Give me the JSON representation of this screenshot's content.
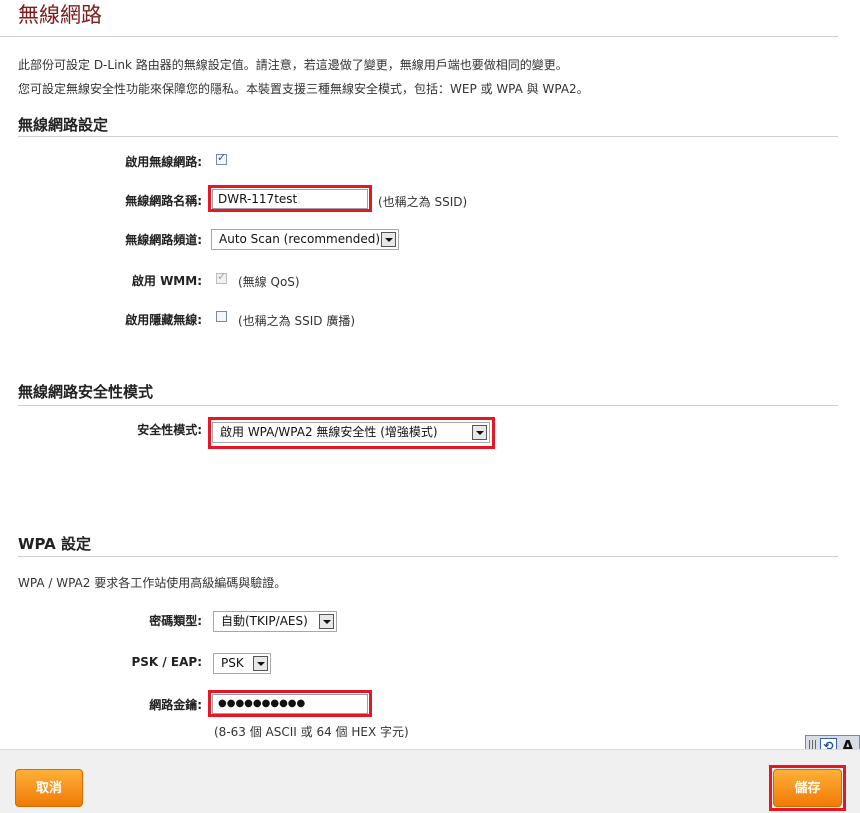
{
  "page": {
    "title": "無線網路",
    "intro_line1": "此部份可設定 D-Link 路由器的無線設定值。請注意，若這邊做了變更，無線用戶端也要做相同的變更。",
    "intro_line2": "您可設定無線安全性功能來保障您的隱私。本裝置支援三種無線安全模式，包括：WEP 或 WPA 與 WPA2。"
  },
  "wireless_settings": {
    "section_title": "無線網路設定",
    "enable_label": "啟用無線網路:",
    "enable_checked": true,
    "ssid_label": "無線網路名稱:",
    "ssid_value": "DWR-117test",
    "ssid_note": "(也稱之為 SSID)",
    "channel_label": "無線網路頻道:",
    "channel_value": "Auto Scan (recommended)",
    "wmm_label": "啟用 WMM:",
    "wmm_checked": true,
    "wmm_note": "(無線 QoS)",
    "hidden_label": "啟用隱藏無線:",
    "hidden_checked": false,
    "hidden_note": "(也稱之為 SSID 廣播)"
  },
  "security_mode": {
    "section_title": "無線網路安全性模式",
    "mode_label": "安全性模式:",
    "mode_value": "啟用 WPA/WPA2 無線安全性 (增強模式)"
  },
  "wpa_settings": {
    "section_title": "WPA 設定",
    "description": "WPA / WPA2 要求各工作站使用高級編碼與驗證。",
    "cipher_label": "密碼類型:",
    "cipher_value": "自動(TKIP/AES)",
    "psk_label": "PSK / EAP:",
    "psk_value": "PSK",
    "key_label": "網路金鑰:",
    "key_value": "●●●●●●●●●●",
    "key_note": "(8-63 個 ASCII 或 64 個 HEX 字元)"
  },
  "footer": {
    "cancel_label": "取消",
    "save_label": "儲存"
  },
  "colors": {
    "title": "#7a1e1e",
    "highlight": "#e31824",
    "button": "#f58a12"
  }
}
